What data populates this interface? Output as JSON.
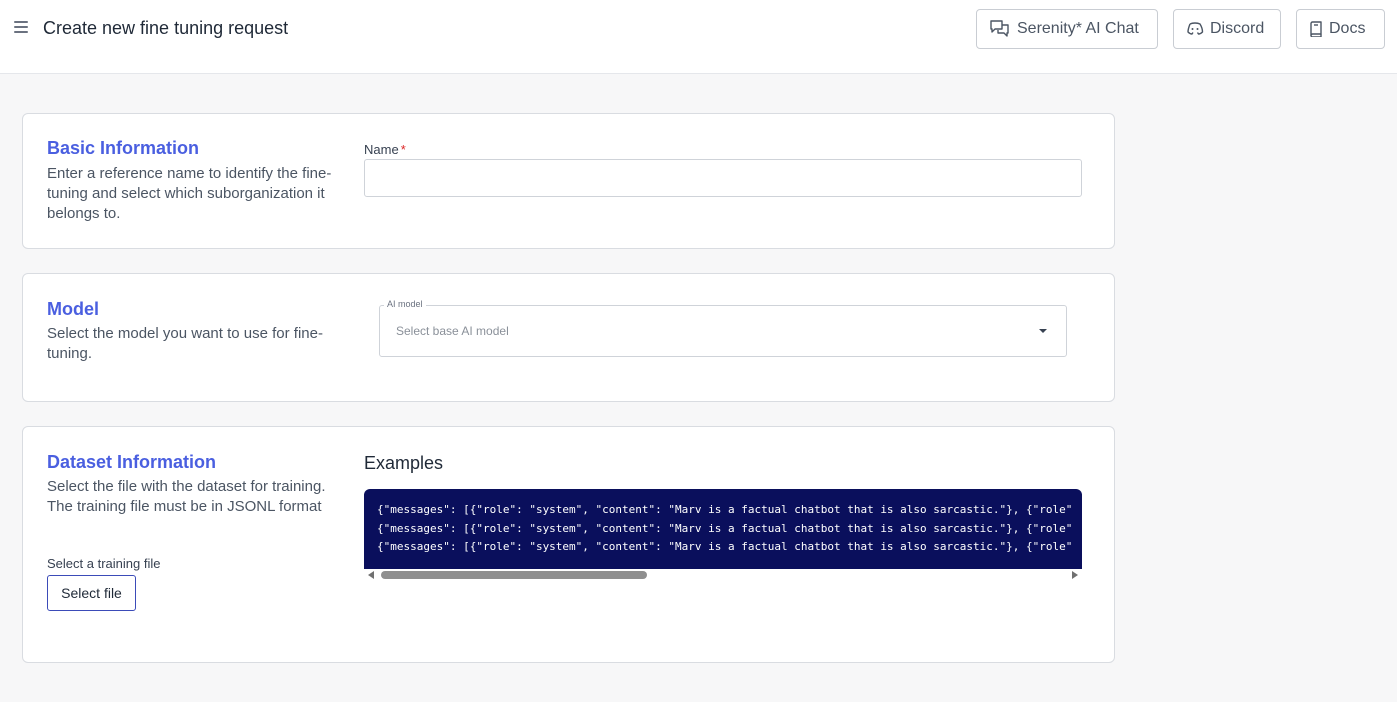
{
  "header": {
    "title": "Create new fine tuning request",
    "buttons": {
      "chat": "Serenity* AI Chat",
      "discord": "Discord",
      "docs": "Docs"
    }
  },
  "basic_information": {
    "title": "Basic Information",
    "description": "Enter a reference name to identify the fine-tuning and select which suborganization it belongs to.",
    "name_label": "Name",
    "required_mark": "*",
    "name_value": ""
  },
  "model": {
    "title": "Model",
    "description": "Select the model you want to use for fine-tuning.",
    "select_label": "AI model",
    "select_placeholder": "Select base AI model"
  },
  "dataset": {
    "title": "Dataset Information",
    "description": "Select the file with the dataset for training. The training file must be in JSONL format",
    "examples_title": "Examples",
    "example_lines": [
      "{\"messages\": [{\"role\": \"system\", \"content\": \"Marv is a factual chatbot that is also sarcastic.\"}, {\"role\"",
      "{\"messages\": [{\"role\": \"system\", \"content\": \"Marv is a factual chatbot that is also sarcastic.\"}, {\"role\"",
      "{\"messages\": [{\"role\": \"system\", \"content\": \"Marv is a factual chatbot that is also sarcastic.\"}, {\"role\""
    ],
    "file_label": "Select a training file",
    "select_file_button": "Select file"
  },
  "icons": {
    "menu": "hamburger-menu-icon",
    "chat": "chat-bubbles-icon",
    "discord": "discord-icon",
    "docs": "book-icon",
    "select": "caret-down-icon"
  },
  "colors": {
    "accent": "#4a5fe0",
    "code_background": "#0a0f5c",
    "required": "#dc2626"
  }
}
